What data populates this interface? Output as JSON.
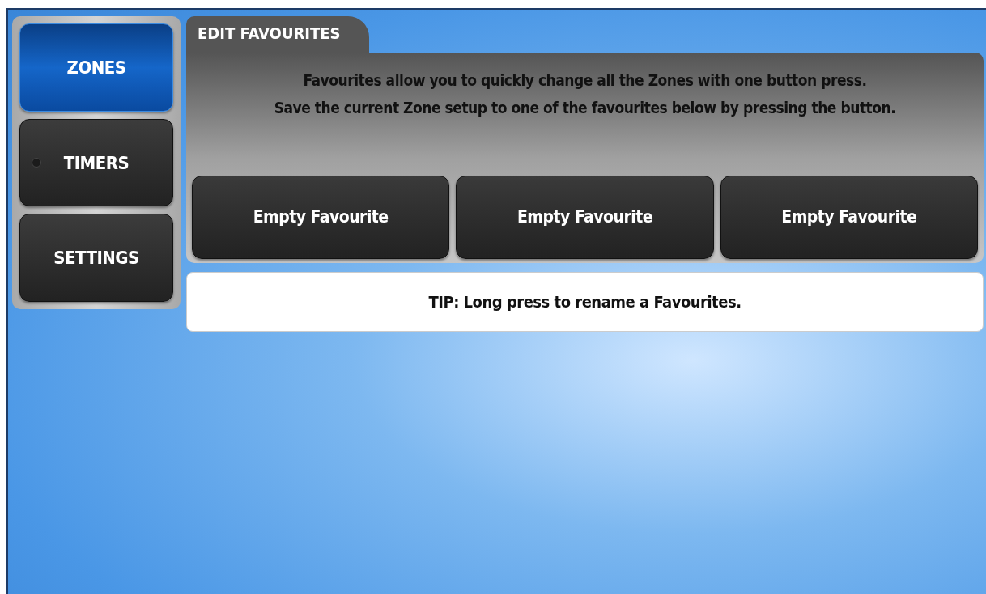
{
  "sidebar": {
    "items": [
      {
        "label": "ZONES",
        "selected": true
      },
      {
        "label": "TIMERS",
        "selected": false,
        "indicator_lit": false
      },
      {
        "label": "SETTINGS",
        "selected": false
      }
    ]
  },
  "panel": {
    "tab": "EDIT FAVOURITES",
    "description": [
      "Favourites allow you to quickly change all the Zones with one button press.",
      "Save the current Zone setup to one of the favourites below by pressing the button."
    ],
    "favourites": [
      "Empty Favourite",
      "Empty Favourite",
      "Empty Favourite"
    ]
  },
  "tip": "TIP: Long press to rename a Favourites."
}
